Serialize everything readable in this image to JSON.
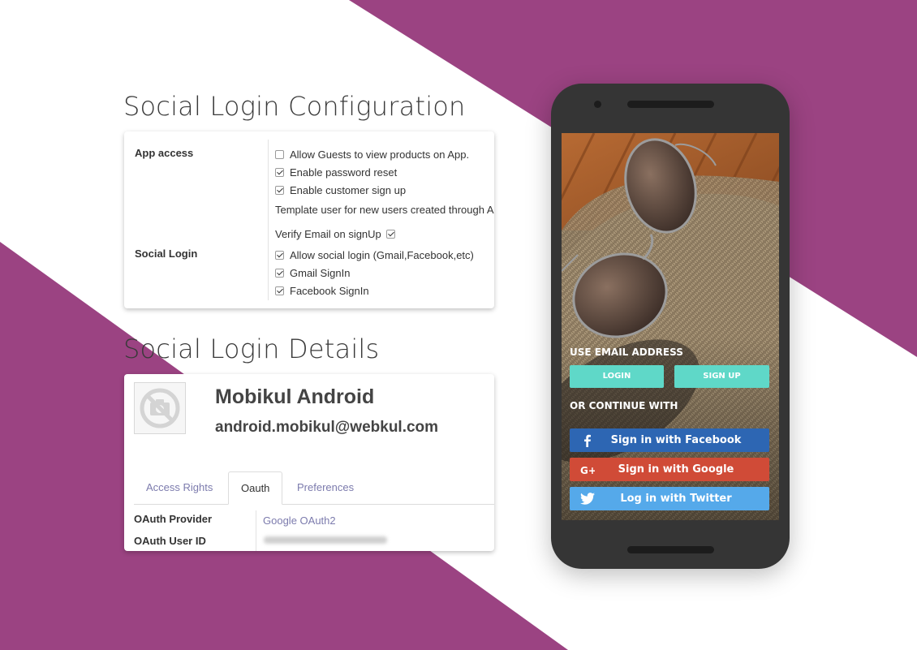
{
  "colors": {
    "brand_purple": "#9b4382",
    "teal_button": "#5fd8c8",
    "facebook": "#2d66b3",
    "google": "#d04b37",
    "twitter": "#55a9ea",
    "link": "#7c7bad"
  },
  "config_section": {
    "title": "Social Login Configuration",
    "app_access_label": "App access",
    "social_login_label": "Social Login",
    "options": [
      {
        "label": "Allow Guests to view products on App.",
        "checked": false
      },
      {
        "label": "Enable password reset",
        "checked": true
      },
      {
        "label": "Enable customer sign up",
        "checked": true
      },
      {
        "label": "Template user for new users created through A",
        "checked": null
      },
      {
        "label": "Verify Email on signUp",
        "checked": true
      },
      {
        "label": "Allow social login (Gmail,Facebook,etc)",
        "checked": true
      },
      {
        "label": "Gmail SignIn",
        "checked": true
      },
      {
        "label": "Facebook SignIn",
        "checked": true
      }
    ]
  },
  "details_section": {
    "title": "Social Login Details",
    "name": "Mobikul Android",
    "email": "android.mobikul@webkul.com",
    "tabs": [
      "Access Rights",
      "Oauth",
      "Preferences"
    ],
    "active_tab": "Oauth",
    "oauth_provider_label": "OAuth Provider",
    "oauth_provider_value": "Google OAuth2",
    "oauth_user_id_label": "OAuth User ID"
  },
  "phone": {
    "use_email_label": "USE EMAIL ADDRESS",
    "login_button": "LOGIN",
    "signup_button": "SIGN UP",
    "continue_label": "OR CONTINUE WITH",
    "facebook_button": "Sign in with Facebook",
    "google_button": "Sign in with Google",
    "twitter_button": "Log in with Twitter"
  }
}
